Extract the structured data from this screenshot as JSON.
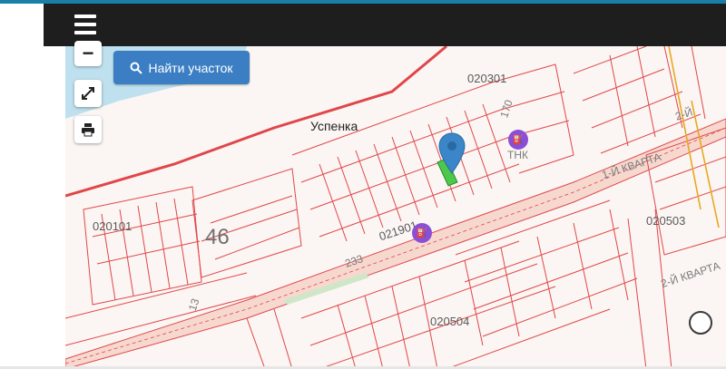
{
  "navbar": {
    "menu_icon": "hamburger-icon"
  },
  "map": {
    "search_button_label": "Найти участок",
    "search_icon": "search-icon",
    "controls": {
      "zoom_out": "−",
      "fullscreen_icon": "expand-icon",
      "print_icon": "printer-icon"
    },
    "labels": {
      "place": "Успенка",
      "block_020301": "020301",
      "block_020101": "020101",
      "block_021901": "021901",
      "block_020503": "020503",
      "block_020504": "020504",
      "zone_46": "46",
      "road_233": "233",
      "road_13": "13",
      "road_170": "170",
      "street_1": "1-Й КВАРТА",
      "street_2": "2-Й КВАРТА",
      "street_2b": "2-Й",
      "poi_tn": "ТНК"
    },
    "colors": {
      "parcel_line": "#e0464a",
      "water": "#bfe0ee",
      "road_fill": "#f6d8cf",
      "accent": "#3b7ec4",
      "marker": "#3a86c8"
    }
  }
}
